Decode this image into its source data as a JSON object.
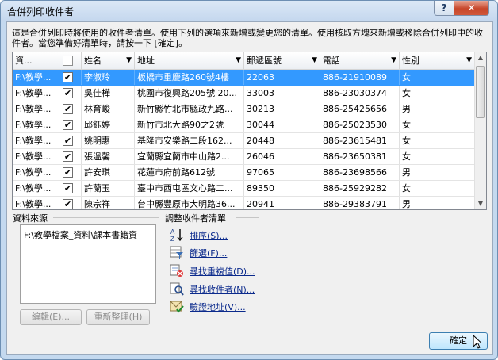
{
  "window": {
    "title": "合併列印收件者",
    "help_label": "?",
    "close_label": "✕"
  },
  "instructions": "這是合併列印時將使用的收件者清單。使用下列的選項來新增或變更您的清單。使用核取方塊來新增或移除合併列印中的收件者。當您準備好清單時，請按一下 [確定]。",
  "table": {
    "columns": [
      "資...",
      "",
      "姓名",
      "地址",
      "郵遞區號",
      "電話",
      "性別"
    ],
    "rows": [
      {
        "source": "F:\\教學...",
        "checked": "✔",
        "name": "李淑玲",
        "address": "板橋市重慶路260號4樓",
        "zip": "22063",
        "phone": "886-21910089",
        "gender": "女",
        "selected": true
      },
      {
        "source": "F:\\教學...",
        "checked": "✔",
        "name": "吳佳樺",
        "address": "桃園市復興路205號 20...",
        "zip": "33003",
        "phone": "886-23030374",
        "gender": "女",
        "selected": false
      },
      {
        "source": "F:\\教學...",
        "checked": "✔",
        "name": "林育峻",
        "address": "新竹縣竹北市縣政九路...",
        "zip": "30213",
        "phone": "886-25425656",
        "gender": "男",
        "selected": false
      },
      {
        "source": "F:\\教學...",
        "checked": "✔",
        "name": "邱鈺婷",
        "address": "新竹市北大路90之2號",
        "zip": "30044",
        "phone": "886-25023530",
        "gender": "女",
        "selected": false
      },
      {
        "source": "F:\\教學...",
        "checked": "✔",
        "name": "姚明惠",
        "address": "基隆市安樂路二段162...",
        "zip": "20448",
        "phone": "886-23615481",
        "gender": "女",
        "selected": false
      },
      {
        "source": "F:\\教學...",
        "checked": "✔",
        "name": "張溫馨",
        "address": "宜蘭縣宜蘭市中山路2...",
        "zip": "26046",
        "phone": "886-23650381",
        "gender": "女",
        "selected": false
      },
      {
        "source": "F:\\教學...",
        "checked": "✔",
        "name": "許安琪",
        "address": "花蓮市府前路612號",
        "zip": "97065",
        "phone": "886-23698566",
        "gender": "男",
        "selected": false
      },
      {
        "source": "F:\\教學...",
        "checked": "✔",
        "name": "許蘭玉",
        "address": "臺中市西屯區文心路二...",
        "zip": "89350",
        "phone": "886-25929282",
        "gender": "女",
        "selected": false
      },
      {
        "source": "F:\\教學...",
        "checked": "✔",
        "name": "陳宗祥",
        "address": "台中縣豐原市大明路36...",
        "zip": "20941",
        "phone": "886-29383791",
        "gender": "男",
        "selected": false
      }
    ]
  },
  "data_source": {
    "label": "資料來源",
    "item": "F:\\教學檔案_資料\\課本書籍資",
    "edit_button": "編輯(E)...",
    "refresh_button": "重新整理(H)"
  },
  "refine": {
    "label": "調整收件者清單",
    "links": [
      {
        "text": "排序(S)...",
        "icon": "sort-icon"
      },
      {
        "text": "篩選(F)...",
        "icon": "filter-icon"
      },
      {
        "text": "尋找重複值(D)...",
        "icon": "find-duplicates-icon"
      },
      {
        "text": "尋找收件者(N)...",
        "icon": "find-recipient-icon"
      },
      {
        "text": "驗證地址(V)...",
        "icon": "validate-address-icon"
      }
    ]
  },
  "ok_button": "確定",
  "colors": {
    "selection": "#3399ff",
    "link": "#0b2a8c",
    "title_bar": "#c4d7ee"
  }
}
